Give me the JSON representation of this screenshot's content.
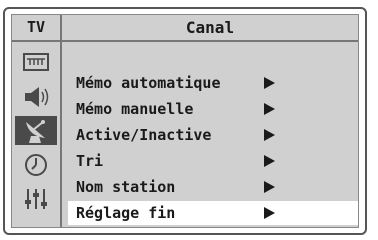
{
  "header": {
    "source_label": "TV",
    "title": "Canal"
  },
  "sidebar": {
    "icons": [
      {
        "name": "picture-icon"
      },
      {
        "name": "sound-icon"
      },
      {
        "name": "channel-antenna-icon",
        "active": true
      },
      {
        "name": "clock-icon"
      },
      {
        "name": "setup-sliders-icon"
      }
    ]
  },
  "menu": {
    "items": [
      {
        "label": "Mémo automatique"
      },
      {
        "label": "Mémo manuelle"
      },
      {
        "label": "Active/Inactive"
      },
      {
        "label": "Tri"
      },
      {
        "label": "Nom station"
      },
      {
        "label": "Réglage fin",
        "selected": true
      }
    ]
  }
}
